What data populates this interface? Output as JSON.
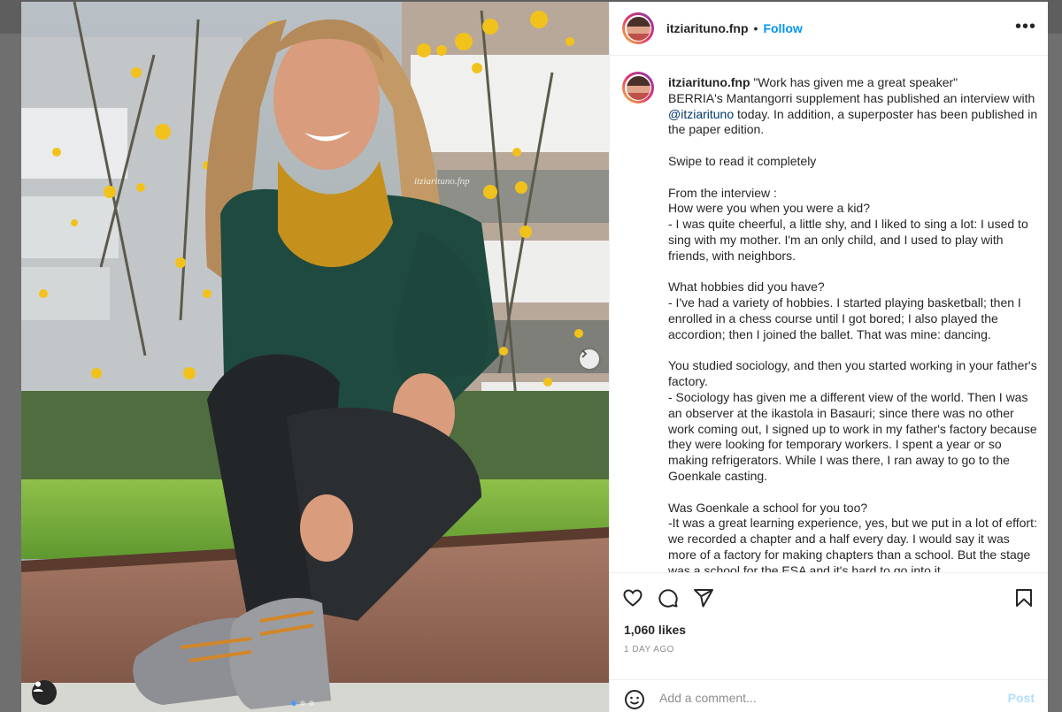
{
  "post": {
    "username": "itziarituno.fnp",
    "follow_label": "Follow",
    "separator": "•",
    "more_label": "•••",
    "image_watermark": "itziarituno.fnp"
  },
  "caption": {
    "username": "itziarituno.fnp",
    "line_1_title": " \"Work has given me a great speaker\"",
    "line_2_before": "BERRIA's Mantangorri supplement has published an interview with ",
    "mention": "@itziarituno",
    "line_2_after": " today. In addition, a superposter has been published in the paper edition.",
    "body": "\nSwipe to read it completely\n\nFrom the interview :\nHow were you when you were a kid?\n- I was quite cheerful, a little shy, and I liked to sing a lot: I used to sing with my mother. I'm an only child, and I used to play with friends, with neighbors.\n\nWhat hobbies did you have?\n- I've had a variety of hobbies. I started playing basketball; then I enrolled in a chess course until I got bored; I also played the accordion; then I joined the ballet. That was mine: dancing.\n\nYou studied sociology, and then you started working in your father's factory.\n- Sociology has given me a different view of the world. Then I was an observer at the ikastola in Basauri; since there was no other work coming out, I signed up to work in my father's factory because they were looking for temporary workers. I spent a year or so making refrigerators. While I was there, I ran away to go to the Goenkale casting.\n\nWas Goenkale a school for you too?\n-It was a great learning experience, yes, but we put in a lot of effort: we recorded a chapter and a half every day. I would say it was more of a factory for making chapters than a school. But the stage was a school for the ESA and it's hard to go into it."
  },
  "stats": {
    "likes": "1,060 likes",
    "time": "1 DAY AGO"
  },
  "comment_box": {
    "placeholder": "Add a comment...",
    "post_label": "Post"
  },
  "icons": {
    "like": "heart-icon",
    "comment": "comment-bubble-icon",
    "share": "paper-plane-icon",
    "save": "bookmark-icon",
    "emoji": "smiley-icon",
    "more": "more-dots-icon",
    "next": "chevron-right-icon",
    "tag": "user-tag-icon"
  },
  "colors": {
    "accent": "#0095f6",
    "text": "#262626",
    "muted": "#8e8e8e",
    "post_disabled": "#b2dffc"
  }
}
